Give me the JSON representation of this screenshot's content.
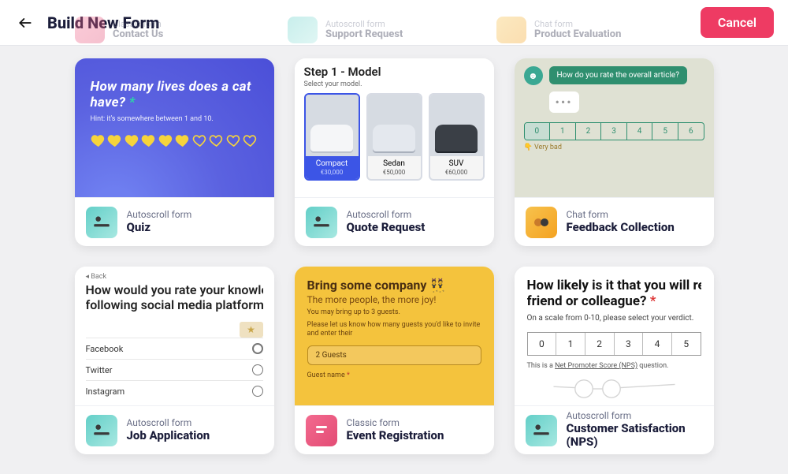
{
  "header": {
    "title": "Build New Form",
    "cancel": "Cancel"
  },
  "peeks": [
    {
      "cat": "Classic form",
      "name": "Contact Us",
      "icon": "pink"
    },
    {
      "cat": "Autoscroll form",
      "name": "Support Request",
      "icon": "teal"
    },
    {
      "cat": "Chat form",
      "name": "Product Evaluation",
      "icon": "yellow"
    }
  ],
  "cards": [
    {
      "id": "quiz",
      "cat": "Autoscroll form",
      "name": "Quiz",
      "icon": "teal",
      "preview": {
        "question": "How many lives does a cat have?",
        "hint": "Hint: it's somewhere between 1 and 10.",
        "filled": 6,
        "total": 10
      }
    },
    {
      "id": "quote",
      "cat": "Autoscroll form",
      "name": "Quote Request",
      "icon": "teal",
      "preview": {
        "step": "Step 1 - Model",
        "sub": "Select your model.",
        "models": [
          {
            "name": "Compact",
            "price": "€30,000",
            "car": "white",
            "selected": true
          },
          {
            "name": "Sedan",
            "price": "€50,000",
            "car": "silver",
            "selected": false
          },
          {
            "name": "SUV",
            "price": "€60,000",
            "car": "black",
            "selected": false
          }
        ]
      }
    },
    {
      "id": "feedback",
      "cat": "Chat form",
      "name": "Feedback Collection",
      "icon": "yellow",
      "preview": {
        "bubble": "How do you rate the overall article?",
        "scale": [
          0,
          1,
          2,
          3,
          4,
          5,
          6
        ],
        "selected": 0,
        "low_label": "👇 Very bad"
      }
    },
    {
      "id": "job",
      "cat": "Autoscroll form",
      "name": "Job Application",
      "icon": "teal",
      "preview": {
        "back": "◂ Back",
        "q1": "How would you rate your knowledge of the",
        "q2": "following social media platforms?",
        "rows": [
          "Facebook",
          "Twitter",
          "Instagram"
        ]
      }
    },
    {
      "id": "event",
      "cat": "Classic form",
      "name": "Event Registration",
      "icon": "pink",
      "preview": {
        "heading": "Bring some company 👯",
        "joy": "The more people, the more joy!",
        "line1": "You may bring up to 3 guests.",
        "line2": "Please let us know how many guests you'd like to invite and enter their",
        "input": "2 Guests",
        "guest_label": "Guest name"
      }
    },
    {
      "id": "nps",
      "cat": "Autoscroll form",
      "name": "Customer Satisfaction (NPS)",
      "icon": "teal",
      "preview": {
        "q1": "How likely is it that you will recommend us to a",
        "q2": "friend or colleague?",
        "sub": "On a scale from 0-10, please select your verdict.",
        "scale": [
          0,
          1,
          2,
          3,
          4,
          5
        ],
        "note_pre": "This is a ",
        "note_link": "Net Promoter Score (NPS)",
        "note_post": " question."
      }
    }
  ]
}
